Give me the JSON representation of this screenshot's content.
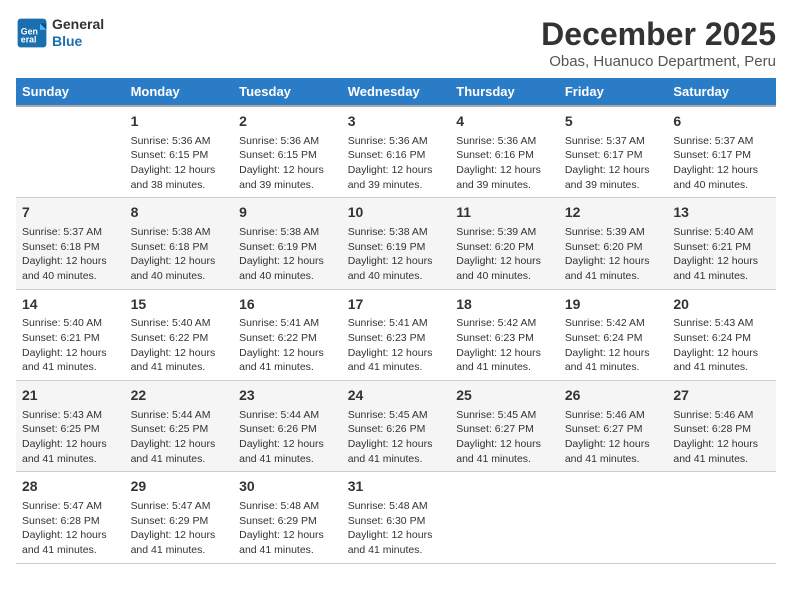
{
  "logo": {
    "line1": "General",
    "line2": "Blue"
  },
  "title": "December 2025",
  "location": "Obas, Huanuco Department, Peru",
  "days_of_week": [
    "Sunday",
    "Monday",
    "Tuesday",
    "Wednesday",
    "Thursday",
    "Friday",
    "Saturday"
  ],
  "weeks": [
    [
      {
        "num": "",
        "info": ""
      },
      {
        "num": "1",
        "info": "Sunrise: 5:36 AM\nSunset: 6:15 PM\nDaylight: 12 hours\nand 38 minutes."
      },
      {
        "num": "2",
        "info": "Sunrise: 5:36 AM\nSunset: 6:15 PM\nDaylight: 12 hours\nand 39 minutes."
      },
      {
        "num": "3",
        "info": "Sunrise: 5:36 AM\nSunset: 6:16 PM\nDaylight: 12 hours\nand 39 minutes."
      },
      {
        "num": "4",
        "info": "Sunrise: 5:36 AM\nSunset: 6:16 PM\nDaylight: 12 hours\nand 39 minutes."
      },
      {
        "num": "5",
        "info": "Sunrise: 5:37 AM\nSunset: 6:17 PM\nDaylight: 12 hours\nand 39 minutes."
      },
      {
        "num": "6",
        "info": "Sunrise: 5:37 AM\nSunset: 6:17 PM\nDaylight: 12 hours\nand 40 minutes."
      }
    ],
    [
      {
        "num": "7",
        "info": "Sunrise: 5:37 AM\nSunset: 6:18 PM\nDaylight: 12 hours\nand 40 minutes."
      },
      {
        "num": "8",
        "info": "Sunrise: 5:38 AM\nSunset: 6:18 PM\nDaylight: 12 hours\nand 40 minutes."
      },
      {
        "num": "9",
        "info": "Sunrise: 5:38 AM\nSunset: 6:19 PM\nDaylight: 12 hours\nand 40 minutes."
      },
      {
        "num": "10",
        "info": "Sunrise: 5:38 AM\nSunset: 6:19 PM\nDaylight: 12 hours\nand 40 minutes."
      },
      {
        "num": "11",
        "info": "Sunrise: 5:39 AM\nSunset: 6:20 PM\nDaylight: 12 hours\nand 40 minutes."
      },
      {
        "num": "12",
        "info": "Sunrise: 5:39 AM\nSunset: 6:20 PM\nDaylight: 12 hours\nand 41 minutes."
      },
      {
        "num": "13",
        "info": "Sunrise: 5:40 AM\nSunset: 6:21 PM\nDaylight: 12 hours\nand 41 minutes."
      }
    ],
    [
      {
        "num": "14",
        "info": "Sunrise: 5:40 AM\nSunset: 6:21 PM\nDaylight: 12 hours\nand 41 minutes."
      },
      {
        "num": "15",
        "info": "Sunrise: 5:40 AM\nSunset: 6:22 PM\nDaylight: 12 hours\nand 41 minutes."
      },
      {
        "num": "16",
        "info": "Sunrise: 5:41 AM\nSunset: 6:22 PM\nDaylight: 12 hours\nand 41 minutes."
      },
      {
        "num": "17",
        "info": "Sunrise: 5:41 AM\nSunset: 6:23 PM\nDaylight: 12 hours\nand 41 minutes."
      },
      {
        "num": "18",
        "info": "Sunrise: 5:42 AM\nSunset: 6:23 PM\nDaylight: 12 hours\nand 41 minutes."
      },
      {
        "num": "19",
        "info": "Sunrise: 5:42 AM\nSunset: 6:24 PM\nDaylight: 12 hours\nand 41 minutes."
      },
      {
        "num": "20",
        "info": "Sunrise: 5:43 AM\nSunset: 6:24 PM\nDaylight: 12 hours\nand 41 minutes."
      }
    ],
    [
      {
        "num": "21",
        "info": "Sunrise: 5:43 AM\nSunset: 6:25 PM\nDaylight: 12 hours\nand 41 minutes."
      },
      {
        "num": "22",
        "info": "Sunrise: 5:44 AM\nSunset: 6:25 PM\nDaylight: 12 hours\nand 41 minutes."
      },
      {
        "num": "23",
        "info": "Sunrise: 5:44 AM\nSunset: 6:26 PM\nDaylight: 12 hours\nand 41 minutes."
      },
      {
        "num": "24",
        "info": "Sunrise: 5:45 AM\nSunset: 6:26 PM\nDaylight: 12 hours\nand 41 minutes."
      },
      {
        "num": "25",
        "info": "Sunrise: 5:45 AM\nSunset: 6:27 PM\nDaylight: 12 hours\nand 41 minutes."
      },
      {
        "num": "26",
        "info": "Sunrise: 5:46 AM\nSunset: 6:27 PM\nDaylight: 12 hours\nand 41 minutes."
      },
      {
        "num": "27",
        "info": "Sunrise: 5:46 AM\nSunset: 6:28 PM\nDaylight: 12 hours\nand 41 minutes."
      }
    ],
    [
      {
        "num": "28",
        "info": "Sunrise: 5:47 AM\nSunset: 6:28 PM\nDaylight: 12 hours\nand 41 minutes."
      },
      {
        "num": "29",
        "info": "Sunrise: 5:47 AM\nSunset: 6:29 PM\nDaylight: 12 hours\nand 41 minutes."
      },
      {
        "num": "30",
        "info": "Sunrise: 5:48 AM\nSunset: 6:29 PM\nDaylight: 12 hours\nand 41 minutes."
      },
      {
        "num": "31",
        "info": "Sunrise: 5:48 AM\nSunset: 6:30 PM\nDaylight: 12 hours\nand 41 minutes."
      },
      {
        "num": "",
        "info": ""
      },
      {
        "num": "",
        "info": ""
      },
      {
        "num": "",
        "info": ""
      }
    ]
  ]
}
